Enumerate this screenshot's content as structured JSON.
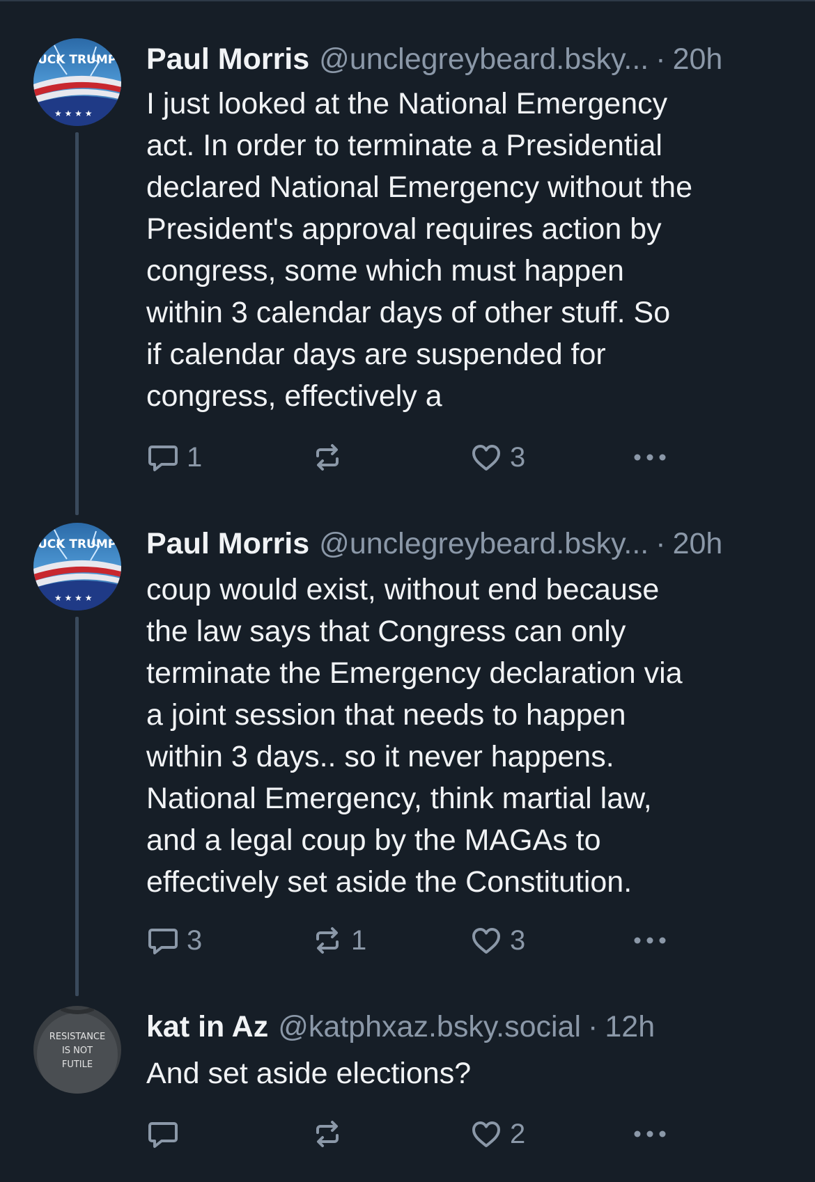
{
  "posts": [
    {
      "avatar_text": "UCK TRUMP",
      "author": "Paul Morris",
      "handle": "@unclegreybeard.bsky...",
      "separator": "·",
      "time": "20h",
      "text": "I just looked at the National Emergency\nact.  In order to terminate a Presidential\ndeclared National Emergency without the\nPresident's approval requires action by\ncongress, some which must happen\nwithin 3 calendar days of other stuff.  So\nif calendar days are suspended for\ncongress, effectively a",
      "replies": "1",
      "reposts": "",
      "likes": "3"
    },
    {
      "avatar_text": "UCK TRUMP",
      "author": "Paul Morris",
      "handle": "@unclegreybeard.bsky...",
      "separator": "·",
      "time": "20h",
      "text": "coup would exist, without end because\nthe law says that Congress can only\nterminate the Emergency declaration via\na joint session that needs to happen\nwithin 3 days.. so it never happens.\nNational Emergency, think martial law,\nand a legal coup by the MAGAs to\neffectively set aside the Constitution.",
      "replies": "3",
      "reposts": "1",
      "likes": "3"
    },
    {
      "avatar_text": "RESISTANCE IS NOT FUTILE",
      "author": "kat in Az",
      "handle": "@katphxaz.bsky.social",
      "separator": "·",
      "time": "12h",
      "text": "And set aside elections?",
      "replies": "",
      "reposts": "",
      "likes": "2"
    }
  ],
  "icons": {
    "reply": "speech-bubble-icon",
    "repost": "repost-arrows-icon",
    "like": "heart-icon",
    "more": "ellipsis-icon"
  },
  "colors": {
    "background": "#161e27",
    "text": "#f1f3f5",
    "muted": "#8b98a8",
    "thread_line": "#3a4a5c"
  }
}
